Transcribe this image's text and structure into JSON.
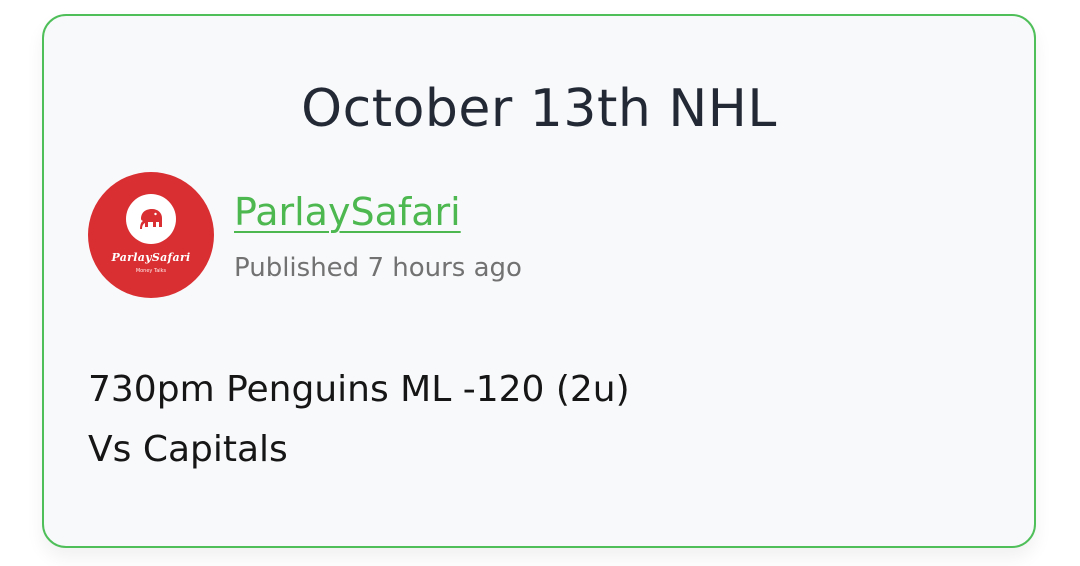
{
  "post": {
    "title": "October 13th NHL",
    "author": {
      "name": "ParlaySafari",
      "avatar_brand_text": "ParlaySafari",
      "avatar_tagline": "Money Talks",
      "avatar_icon": "elephant-icon"
    },
    "published_text": "Published 7 hours ago",
    "body_lines": [
      "730pm Penguins ML -120 (2u)",
      "Vs Capitals"
    ]
  },
  "colors": {
    "card_border": "#4fbf5a",
    "card_background": "#f8f9fb",
    "author_link": "#4cb84f",
    "avatar_background": "#d92f32",
    "title_text": "#232a36",
    "meta_text": "#727272",
    "body_text": "#161616"
  }
}
